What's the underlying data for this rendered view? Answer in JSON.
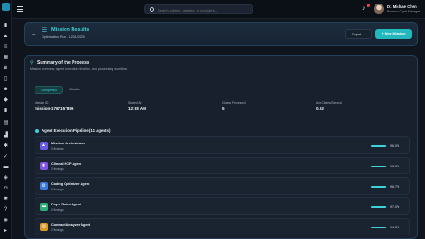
{
  "topbar": {
    "search_placeholder": "Search claims, patients, or providers...",
    "user_name": "Dr. Michael Chen",
    "user_role": "Revenue Cycle Manager"
  },
  "header": {
    "title": "Mission Results",
    "subtitle": "Optimization Run - 12/31/2025",
    "export_label": "Export",
    "new_mission_label": "+ New Mission"
  },
  "summary": {
    "title": "Summary of the Process",
    "subtitle": "Mission overview, agent execution timeline, and processing workflow",
    "tabs": [
      {
        "label": "Completed"
      },
      {
        "label": "Details"
      }
    ],
    "stats": [
      {
        "label": "Mission ID",
        "value": "mission-1767157896"
      },
      {
        "label": "Started At",
        "value": "12:38 AM"
      },
      {
        "label": "Claims Processed",
        "value": "5"
      },
      {
        "label": "Avg Claims/Second",
        "value": "0.02"
      }
    ]
  },
  "pipeline": {
    "title": "Agent Execution Pipeline (11 Agents)",
    "agents": [
      {
        "name": "Mission Orchestrator",
        "findings": "3 findings",
        "progress": 96.0,
        "progress_label": "96.0%",
        "color": "#6a5be0"
      },
      {
        "name": "Clinical NCP Agent",
        "findings": "2 findings",
        "progress": 93.3,
        "progress_label": "93.3%",
        "color": "#7f55e0"
      },
      {
        "name": "Coding Optimizer Agent",
        "findings": "3 findings",
        "progress": 96.7,
        "progress_label": "96.7%",
        "color": "#3d79d8"
      },
      {
        "name": "Payer Rules Agent",
        "findings": "2 findings",
        "progress": 97.0,
        "progress_label": "97.0%",
        "color": "#2fae7a"
      },
      {
        "name": "Contract Analyzer Agent",
        "findings": "2 findings",
        "progress": 94.3,
        "progress_label": "94.3%",
        "color": "#d99a2a"
      }
    ]
  }
}
